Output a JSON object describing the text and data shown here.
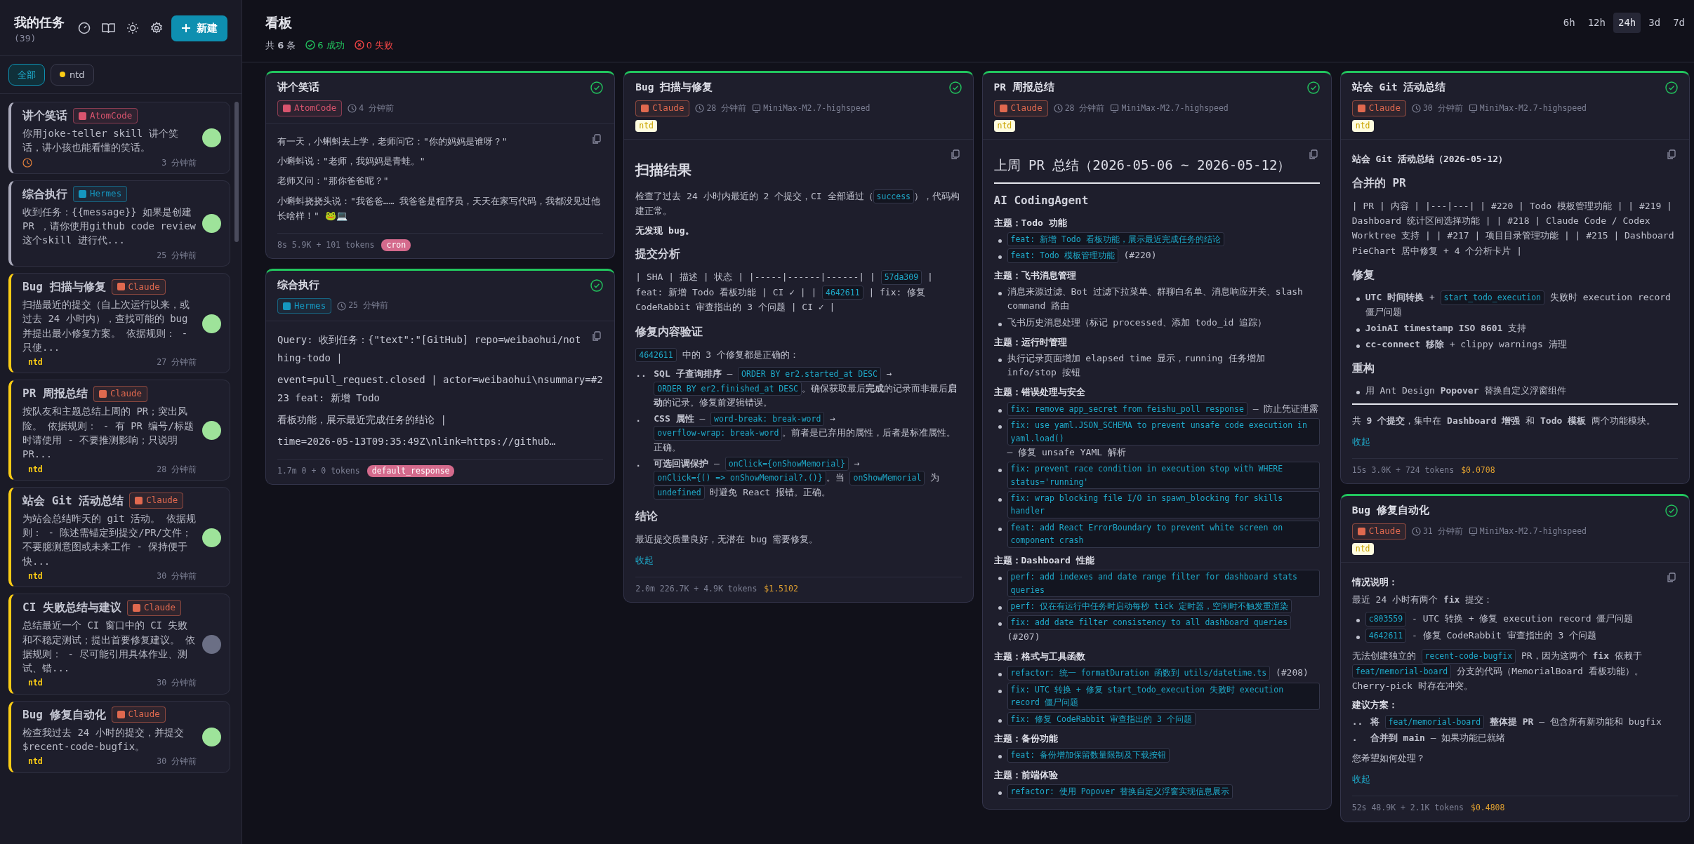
{
  "sidebar": {
    "title": "我的任务",
    "count": "(39)",
    "new_button": "新建",
    "filters": [
      {
        "label": "全部",
        "selected": true
      },
      {
        "label": "ntd",
        "selected": false,
        "color": "#facc15"
      }
    ],
    "tasks": [
      {
        "title": "讲个笑话",
        "agent": {
          "name": "AtomCode",
          "color": "#d9546e"
        },
        "description": "你用joke-teller skill 讲个笑话，讲小孩也能看懂的笑话。",
        "scheduled": true,
        "time": "3 分钟前",
        "done": true
      },
      {
        "title": "综合执行",
        "agent": {
          "name": "Hermes",
          "color": "#1597c0"
        },
        "description": "收到任务：{{message}} 如果是创建 PR ，请你使用github code review 这个skill 进行代...",
        "time": "25 分钟前",
        "done": true
      },
      {
        "title": "Bug 扫描与修复",
        "agent": {
          "name": "Claude",
          "color": "#e0694f"
        },
        "description": "扫描最近的提交（自上次运行以来，或过去 24 小时内），查找可能的 bug 并提出最小修复方案。 依据规则： - 只使...",
        "tag": "ntd",
        "time": "27 分钟前",
        "done": true
      },
      {
        "title": "PR 周报总结",
        "agent": {
          "name": "Claude",
          "color": "#e0694f"
        },
        "description": "按队友和主题总结上周的 PR；突出风险。 依据规则： - 有 PR 编号/标题时请使用 - 不要推测影响；只说明 PR...",
        "tag": "ntd",
        "time": "28 分钟前",
        "done": true
      },
      {
        "title": "站会 Git 活动总结",
        "agent": {
          "name": "Claude",
          "color": "#e0694f"
        },
        "description": "为站会总结昨天的 git 活动。 依据规则： - 陈述需锚定到提交/PR/文件；不要臆测意图或未来工作 - 保持便于快...",
        "tag": "ntd",
        "time": "30 分钟前",
        "done": true
      },
      {
        "title": "CI 失败总结与建议",
        "agent": {
          "name": "Claude",
          "color": "#e0694f"
        },
        "description": "总结最近一个 CI 窗口中的 CI 失败和不稳定测试；提出首要修复建议。 依据规则： - 尽可能引用具体作业、测试、错...",
        "tag": "ntd",
        "time": "30 分钟前",
        "done": false
      },
      {
        "title": "Bug 修复自动化",
        "agent": {
          "name": "Claude",
          "color": "#e0694f"
        },
        "description": "检查我过去 24 小时的提交，并提交 $recent-code-bugfix。",
        "tag": "ntd",
        "time": "30 分钟前",
        "done": true
      }
    ]
  },
  "header": {
    "title": "看板",
    "total": "共 **6** 条",
    "success": "6 成功",
    "failed": "0 失败",
    "ranges": [
      {
        "label": "6h",
        "selected": false
      },
      {
        "label": "12h",
        "selected": false
      },
      {
        "label": "24h",
        "selected": true
      },
      {
        "label": "3d",
        "selected": false
      },
      {
        "label": "7d",
        "selected": false
      }
    ]
  },
  "columns": [
    [
      {
        "title": "讲个笑话",
        "succeeded": true,
        "agent": {
          "name": "AtomCode",
          "color": "#d9546e"
        },
        "time": "4 分钟前",
        "body": [
          {
            "kind": "p",
            "parts": [
              "有一天，小蝌蚪去上学，老师问它：\"你的妈妈是谁呀？\""
            ]
          },
          {
            "kind": "p",
            "parts": [
              "小蝌蚪说：\"老师，我妈妈是青蛙。\""
            ]
          },
          {
            "kind": "p",
            "parts": [
              "老师又问：\"那你爸爸呢？\""
            ]
          },
          {
            "kind": "p",
            "parts": [
              "小蝌蚪挠挠头说：\"我爸爸…… 我爸爸是程序员，天天在家写代码，我都没见过他长啥样！\" 🐸💻"
            ]
          }
        ],
        "footer": {
          "stats": "8s 5.9K + 101 tokens",
          "badge": "cron"
        }
      },
      {
        "title": "综合执行",
        "succeeded": true,
        "agent": {
          "name": "Hermes",
          "color": "#1597c0"
        },
        "time": "25 分钟前",
        "body": [
          {
            "kind": "mono",
            "parts": [
              "Query: 收到任务：{\"text\":\"[GitHub] repo=weibaohui/nothing-todo |"
            ]
          },
          {
            "kind": "mono",
            "parts": [
              "event=pull_request.closed | actor=weibaohui\\nsummary=#223 feat: 新增 Todo"
            ]
          },
          {
            "kind": "mono",
            "parts": [
              "看板功能，展示最近完成任务的结论 |"
            ]
          },
          {
            "kind": "mono",
            "parts": [
              "time=2026-05-13T09:35:49Z\\nlink=https://github…"
            ]
          }
        ],
        "footer": {
          "stats": "1.7m 0 + 0 tokens",
          "badge": "default_response"
        }
      }
    ],
    [
      {
        "title": "Bug 扫描与修复",
        "succeeded": true,
        "agent": {
          "name": "Claude",
          "color": "#e0694f"
        },
        "time": "28 分钟前",
        "model": "MiniMax-M2.7-highspeed",
        "tag": "ntd",
        "body": [
          {
            "kind": "h2",
            "text": "扫描结果"
          },
          {
            "kind": "p",
            "parts": [
              "检查了过去 24 小时内最近的 2 个提交，CI 全部通过（",
              {
                "code": "success"
              },
              "），代码构建正常。"
            ]
          },
          {
            "kind": "label",
            "text": "无发现 bug。"
          },
          {
            "kind": "h3",
            "text": "提交分析"
          },
          {
            "kind": "p",
            "parts": [
              "| SHA | 描述 | 状态 | |-----|------|------| | ",
              {
                "code": "57da309"
              },
              " | feat: 新增 Todo 看板功能 | CI ✓ | | ",
              {
                "code": "4642611"
              },
              " | fix: 修复 CodeRabbit 审查指出的 3 个问题 | CI ✓ |"
            ]
          },
          {
            "kind": "h3",
            "text": "修复内容验证"
          },
          {
            "kind": "p",
            "parts": [
              {
                "code": "4642611"
              },
              " 中的 3 个修复都是正确的："
            ]
          },
          {
            "kind": "ol",
            "items": [
              {
                "marker": "..",
                "parts": [
                  "**SQL 子查询排序** — ",
                  {
                    "code": "ORDER BY er2.started_at DESC"
                  },
                  " → ",
                  {
                    "code": "ORDER BY er2.finished_at DESC"
                  },
                  "。确保获取最后**完成**的记录而非最后**启动**的记录。修复前逻辑错误。"
                ]
              },
              {
                "marker": ".",
                "parts": [
                  "**CSS 属性** — ",
                  {
                    "code": "word-break: break-word"
                  },
                  " → ",
                  {
                    "code": "overflow-wrap: break-word"
                  },
                  "。前者是已弃用的属性，后者是标准属性。正确。"
                ]
              },
              {
                "marker": ".",
                "parts": [
                  "**可选回调保护** — ",
                  {
                    "code": "onClick={onShowMemorial}"
                  },
                  " → ",
                  {
                    "code": "onClick={() => onShowMemorial?.()}"
                  },
                  "。当 ",
                  {
                    "code": "onShowMemorial"
                  },
                  " 为 ",
                  {
                    "code": "undefined"
                  },
                  " 时避免 React 报错。正确。"
                ]
              }
            ]
          },
          {
            "kind": "h3",
            "text": "结论"
          },
          {
            "kind": "p",
            "parts": [
              "最近提交质量良好，无潜在 bug 需要修复。"
            ]
          }
        ],
        "collapse": "收起",
        "footer": {
          "stats": "2.0m 226.7K + 4.9K tokens",
          "cost": "$1.5102"
        }
      }
    ],
    [
      {
        "title": "PR 周报总结",
        "succeeded": true,
        "agent": {
          "name": "Claude",
          "color": "#e0694f"
        },
        "time": "28 分钟前",
        "model": "MiniMax-M2.7-highspeed",
        "tag": "ntd",
        "body": [
          {
            "kind": "h1",
            "text": "上周 PR 总结（2026-05-06 ~ 2026-05-12）"
          },
          {
            "kind": "hr"
          },
          {
            "kind": "h3",
            "text": "AI CodingAgent"
          },
          {
            "kind": "label",
            "text": "主题：Todo 功能"
          },
          {
            "kind": "ul",
            "items": [
              [
                {
                  "code": "feat: 新增 Todo 看板功能，展示最近完成任务的结论"
                }
              ],
              [
                {
                  "code": "feat: Todo 模板管理功能"
                },
                " (#220)"
              ]
            ]
          },
          {
            "kind": "label",
            "text": "主题：飞书消息管理"
          },
          {
            "kind": "ul",
            "items": [
              [
                "消息来源过滤、Bot 过滤下拉菜单、群聊白名单、消息响应开关、slash command 路由"
              ],
              [
                "飞书历史消息处理（标记 processed、添加 todo_id 追踪）"
              ]
            ]
          },
          {
            "kind": "label",
            "text": "主题：运行时管理"
          },
          {
            "kind": "ul",
            "items": [
              [
                "执行记录页面增加 elapsed time 显示，running 任务增加 info/stop 按钮"
              ]
            ]
          },
          {
            "kind": "label",
            "text": "主题：错误处理与安全"
          },
          {
            "kind": "ul",
            "items": [
              [
                {
                  "code": "fix: remove app_secret from feishu_poll response"
                },
                " — 防止凭证泄露"
              ],
              [
                {
                  "code": "fix: use yaml.JSON_SCHEMA to prevent unsafe code execution in yaml.load()"
                },
                " — 修复 unsafe YAML 解析"
              ],
              [
                {
                  "code": "fix: prevent race condition in execution stop with WHERE status='running'"
                }
              ],
              [
                {
                  "code": "fix: wrap blocking file I/O in spawn_blocking for skills handler"
                }
              ],
              [
                {
                  "code": "feat: add React ErrorBoundary to prevent white screen on component crash"
                }
              ]
            ]
          },
          {
            "kind": "label",
            "text": "主题：Dashboard 性能"
          },
          {
            "kind": "ul",
            "items": [
              [
                {
                  "code": "perf: add indexes and date range filter for dashboard stats queries"
                }
              ],
              [
                {
                  "code": "perf: 仅在有运行中任务时启动每秒 tick 定时器，空闲时不触发重渲染"
                }
              ],
              [
                {
                  "code": "fix: add date filter consistency to all dashboard queries"
                },
                " (#207)"
              ]
            ]
          },
          {
            "kind": "label",
            "text": "主题：格式与工具函数"
          },
          {
            "kind": "ul",
            "items": [
              [
                {
                  "code": "refactor: 统一 formatDuration 函数到 utils/datetime.ts"
                },
                " (#208)"
              ],
              [
                {
                  "code": "fix: UTC 转换 + 修复 start_todo_execution 失败时 execution record 僵尸问题"
                }
              ],
              [
                {
                  "code": "fix: 修复 CodeRabbit 审查指出的 3 个问题"
                }
              ]
            ]
          },
          {
            "kind": "label",
            "text": "主题：备份功能"
          },
          {
            "kind": "ul",
            "items": [
              [
                {
                  "code": "feat: 备份增加保留数量限制及下载按钮"
                }
              ]
            ]
          },
          {
            "kind": "label",
            "text": "主题：前端体验"
          },
          {
            "kind": "ul",
            "items": [
              [
                {
                  "code": "refactor: 使用 Popover 替换自定义浮窗实现信息展示"
                }
              ]
            ]
          }
        ]
      }
    ],
    [
      {
        "title": "站会 Git 活动总结",
        "succeeded": true,
        "agent": {
          "name": "Claude",
          "color": "#e0694f"
        },
        "time": "30 分钟前",
        "model": "MiniMax-M2.7-highspeed",
        "tag": "ntd",
        "body": [
          {
            "kind": "label",
            "text": "站会 Git 活动总结（2026-05-12）"
          },
          {
            "kind": "h3",
            "text": "合并的 PR"
          },
          {
            "kind": "p",
            "parts": [
              "| PR | 内容 | |---|---| | #220 | Todo 模板管理功能 | | #219 | Dashboard 统计区间选择功能 | | #218 | Claude Code / Codex Worktree 支持 | | #217 | 项目目录管理功能 | | #215 | Dashboard PieChart 居中修复 + 4 个分析卡片 |"
            ]
          },
          {
            "kind": "h3",
            "text": "修复"
          },
          {
            "kind": "ul",
            "items": [
              [
                "**UTC 时间转换** + ",
                {
                  "code": "start_todo_execution"
                },
                " 失败时 execution record 僵尸问题"
              ],
              [
                "**JoinAI timestamp ISO 8601** 支持"
              ],
              [
                "**cc-connect 移除** + clippy warnings 清理"
              ]
            ]
          },
          {
            "kind": "h3",
            "text": "重构"
          },
          {
            "kind": "ul",
            "items": [
              [
                "用 Ant Design **Popover** 替换自定义浮窗组件"
              ]
            ]
          },
          {
            "kind": "hr"
          },
          {
            "kind": "p",
            "parts": [
              "共 **9 个提交**，集中在 **Dashboard 增强** 和 **Todo 模板** 两个功能模块。"
            ]
          }
        ],
        "collapse": "收起",
        "footer": {
          "stats": "15s 3.0K + 724 tokens",
          "cost": "$0.0708"
        }
      },
      {
        "title": "Bug 修复自动化",
        "succeeded": true,
        "agent": {
          "name": "Claude",
          "color": "#e0694f"
        },
        "time": "31 分钟前",
        "model": "MiniMax-M2.7-highspeed",
        "tag": "ntd",
        "body": [
          {
            "kind": "label",
            "text": "情况说明："
          },
          {
            "kind": "p",
            "parts": [
              "最近 24 小时有两个 **fix** 提交："
            ]
          },
          {
            "kind": "ul",
            "items": [
              [
                {
                  "code": "c803559"
                },
                " - UTC 转换 + 修复 execution record 僵尸问题"
              ],
              [
                {
                  "code": "4642611"
                },
                " - 修复 CodeRabbit 审查指出的 3 个问题"
              ]
            ]
          },
          {
            "kind": "p",
            "parts": [
              "无法创建独立的 ",
              {
                "code": "recent-code-bugfix"
              },
              " PR，因为这两个 **fix** 依赖于 ",
              {
                "code": "feat/memorial-board"
              },
              " 分支的代码（MemorialBoard 看板功能）。Cherry-pick 时存在冲突。"
            ]
          },
          {
            "kind": "label",
            "text": "建议方案："
          },
          {
            "kind": "ol",
            "items": [
              {
                "marker": "..",
                "parts": [
                  "**将** ",
                  {
                    "code": "feat/memorial-board"
                  },
                  " **整体提 PR** — 包含所有新功能和 bugfix"
                ]
              },
              {
                "marker": ".",
                "parts": [
                  "**合并到 main** — 如果功能已就绪"
                ]
              }
            ]
          },
          {
            "kind": "p",
            "parts": [
              "您希望如何处理？"
            ]
          }
        ],
        "collapse": "收起",
        "footer": {
          "stats": "52s 48.9K + 2.1K tokens",
          "cost": "$0.4808"
        }
      }
    ]
  ]
}
